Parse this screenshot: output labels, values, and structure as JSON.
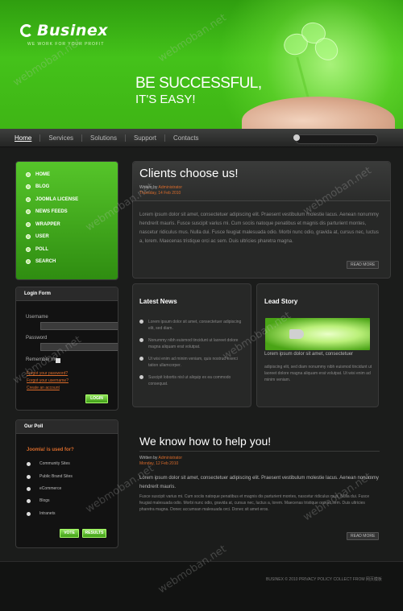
{
  "header": {
    "logo": "Businex",
    "tagline": "WE WORK FOR YOUR PROFIT",
    "slogan_line1": "BE SUCCESSFUL,",
    "slogan_line2": "IT'S EASY!"
  },
  "nav": {
    "items": [
      "Home",
      "Services",
      "Solutions",
      "Support",
      "Contacts"
    ]
  },
  "sidebar_menu": {
    "items": [
      "HOME",
      "BLOG",
      "JOOMLA LICENSE",
      "NEWS FEEDS",
      "WRAPPER",
      "USER",
      "POLL",
      "SEARCH"
    ]
  },
  "login": {
    "title": "Login Form",
    "username_label": "Username",
    "password_label": "Password",
    "remember_label": "Remember me",
    "forgot_password": "Forgot your password?",
    "forgot_username": "Forgot your username?",
    "create_account": "Create an account",
    "login_button": "LOGIN"
  },
  "poll": {
    "title": "Our Poll",
    "question": "Joomla! is used for?",
    "options": [
      "Community Sites",
      "Public Brand Sites",
      "eCommerce",
      "Blogs",
      "Intranets"
    ],
    "vote_button": "VOTE",
    "results_button": "RESULTS"
  },
  "clients": {
    "title": "Clients choose us!",
    "written_by": "Written by",
    "author": "Administrator",
    "date": "Thursday, 14 Feb 2010",
    "body": "Lorem ipsum dolor sit amet, consectetuer adipiscing elit. Praesent vestibulum molestie lacus. Aenean nonummy hendrerit mauris. Fusce suscipit varius mi. Cum sociis natoque penatibus et magnis dis parturient montes, nascetur ridiculus mus. Nulla dui. Fusce feugiat malesuada odio. Morbi nunc odio, gravida at, cursus nec, luctus a, lorem. Maecenas tristique orci ac sem. Duis ultricies pharetra magna.",
    "read_more": "READ MORE"
  },
  "latest_news": {
    "title": "Latest News",
    "items": [
      "Lorem ipsum dolor sit amet, consectetuer adipiscing elit, sed diam.",
      "Nonummy nibh euismod tincidunt ut laoreet dolore magna aliquam erat volutpat.",
      "Ut wisi enim ad minim veniam, quis nostrud exerci tation ullamcorper.",
      "Suscipit lobortis nisl ut aliquip ex ea commodo consequat."
    ]
  },
  "lead_story": {
    "title": "Lead Story",
    "headline": "Lorem ipsum dolor sit amet, consectetuer",
    "body": "adipiscing elit, sed diam nonummy nibh euismod tincidunt ut laoreet dolore magna aliquam erat volutpat. Ut wisi enim ad minim veniam."
  },
  "help": {
    "title": "We know how to help you!",
    "written_by": "Written by",
    "author": "Administrator",
    "date": "Monday, 12 Feb 2010",
    "body_lead": "Lorem ipsum dolor sit amet, consectetuer adipiscing elit. Praesent vestibulum molestie lacus. Aenean nonummy hendrerit mauris.",
    "body": "Fusce suscipit varius mi. Cum sociis natoque penatibus et magnis dis parturient montes, nascetur ridiculus mus. Nulla dui. Fusce feugiat malesuada odio. Morbi nunc odio, gravida at, cursus nec, luctus a, lorem. Maecenas tristique orci ac sem. Duis ultricies pharetra magna. Donec accumsan malesuada orci. Donec sit amet eros.",
    "read_more": "READ MORE"
  },
  "footer": {
    "copyright": "BUSINEX © 2010 PRIVACY POLICY   COLLECT FROM 网页模板"
  },
  "watermark": "webmoban.net"
}
